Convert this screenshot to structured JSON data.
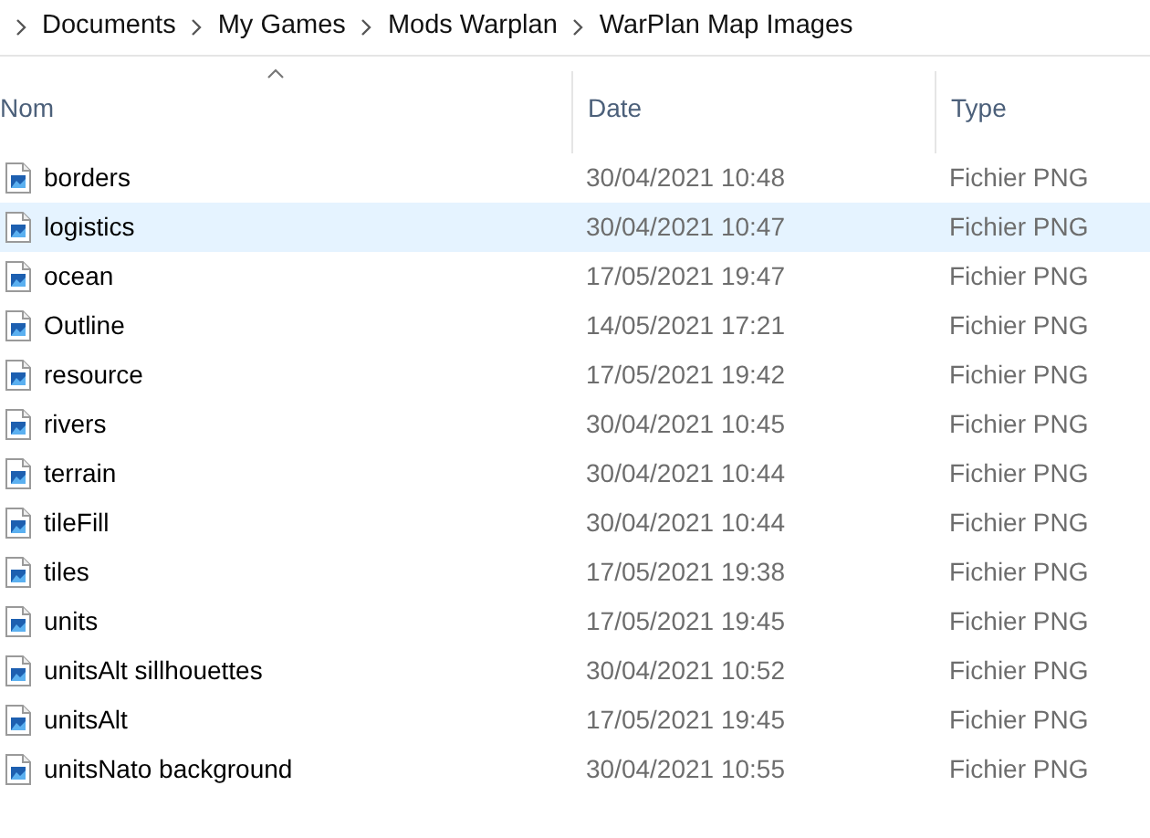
{
  "breadcrumb": [
    "Documents",
    "My Games",
    "Mods Warplan",
    "WarPlan Map Images"
  ],
  "columns": [
    {
      "label": "Nom",
      "sorted": true
    },
    {
      "label": "Date",
      "sorted": false
    },
    {
      "label": "Type",
      "sorted": false
    }
  ],
  "rows": [
    {
      "name": "borders",
      "date": "30/04/2021 10:48",
      "type": "Fichier PNG",
      "selected": false
    },
    {
      "name": "logistics",
      "date": "30/04/2021 10:47",
      "type": "Fichier PNG",
      "selected": true
    },
    {
      "name": "ocean",
      "date": "17/05/2021 19:47",
      "type": "Fichier PNG",
      "selected": false
    },
    {
      "name": "Outline",
      "date": "14/05/2021 17:21",
      "type": "Fichier PNG",
      "selected": false
    },
    {
      "name": "resource",
      "date": "17/05/2021 19:42",
      "type": "Fichier PNG",
      "selected": false
    },
    {
      "name": "rivers",
      "date": "30/04/2021 10:45",
      "type": "Fichier PNG",
      "selected": false
    },
    {
      "name": "terrain",
      "date": "30/04/2021 10:44",
      "type": "Fichier PNG",
      "selected": false
    },
    {
      "name": "tileFill",
      "date": "30/04/2021 10:44",
      "type": "Fichier PNG",
      "selected": false
    },
    {
      "name": "tiles",
      "date": "17/05/2021 19:38",
      "type": "Fichier PNG",
      "selected": false
    },
    {
      "name": "units",
      "date": "17/05/2021 19:45",
      "type": "Fichier PNG",
      "selected": false
    },
    {
      "name": "unitsAlt sillhouettes",
      "date": "30/04/2021 10:52",
      "type": "Fichier PNG",
      "selected": false
    },
    {
      "name": "unitsAlt",
      "date": "17/05/2021 19:45",
      "type": "Fichier PNG",
      "selected": false
    },
    {
      "name": "unitsNato background",
      "date": "30/04/2021 10:55",
      "type": "Fichier PNG",
      "selected": false
    }
  ]
}
